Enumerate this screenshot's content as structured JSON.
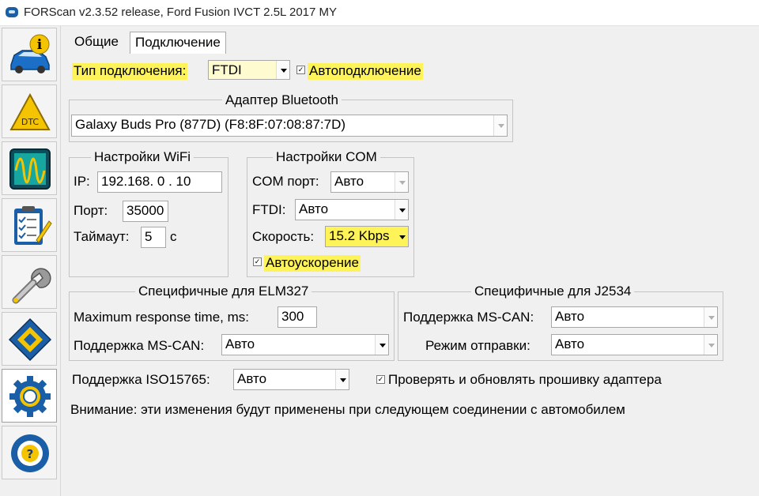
{
  "window": {
    "title": "FORScan v2.3.52 release, Ford Fusion IVCT 2.5L 2017 MY"
  },
  "sidebar": {
    "items": [
      {
        "name": "vehicle-info-icon"
      },
      {
        "name": "dtc-icon",
        "text": "DTC"
      },
      {
        "name": "oscilloscope-icon"
      },
      {
        "name": "checklist-icon"
      },
      {
        "name": "service-wrench-icon"
      },
      {
        "name": "module-chip-icon"
      },
      {
        "name": "settings-gear-icon",
        "active": true
      },
      {
        "name": "help-steering-wheel-icon",
        "text": "?"
      }
    ]
  },
  "tabs": [
    {
      "label": "Общие"
    },
    {
      "label": "Подключение",
      "active": true
    }
  ],
  "connection": {
    "type_label": "Тип подключения:",
    "type_value": "FTDI",
    "autoconnect_label": "Автоподключение",
    "autoconnect_checked": true
  },
  "bluetooth": {
    "title": "Адаптер Bluetooth",
    "device": "Galaxy Buds Pro (877D) (F8:8F:07:08:87:7D)"
  },
  "wifi": {
    "title": "Настройки WiFi",
    "ip_label": "IP:",
    "ip_value": "192.168.  0 . 10",
    "port_label": "Порт:",
    "port_value": "35000",
    "timeout_label": "Таймаут:",
    "timeout_value": "5",
    "timeout_unit": "с"
  },
  "com": {
    "title": "Настройки COM",
    "port_label": "COM порт:",
    "port_value": "Авто",
    "ftdi_label": "FTDI:",
    "ftdi_value": "Авто",
    "speed_label": "Скорость:",
    "speed_value": "15.2 Kbps",
    "autoboost_label": "Автоускорение",
    "autoboost_checked": true
  },
  "elm327": {
    "title": "Специфичные для ELM327",
    "resp_label": "Maximum response time, ms:",
    "resp_value": "300",
    "mscan_label": "Поддержка MS-CAN:",
    "mscan_value": "Авто"
  },
  "j2534": {
    "title": "Специфичные для J2534",
    "mscan_label": "Поддержка MS-CAN:",
    "mscan_value": "Авто",
    "send_label": "Режим отправки:",
    "send_value": "Авто"
  },
  "iso": {
    "label": "Поддержка ISO15765:",
    "value": "Авто"
  },
  "firmware": {
    "label": "Проверять и обновлять прошивку адаптера",
    "checked": true
  },
  "notice": "Внимание: эти изменения будут применены при следующем соединении с автомобилем",
  "colors": {
    "highlight": "#fff35a",
    "accent_blue": "#1b5ea8",
    "icon_yellow": "#f5c400"
  }
}
